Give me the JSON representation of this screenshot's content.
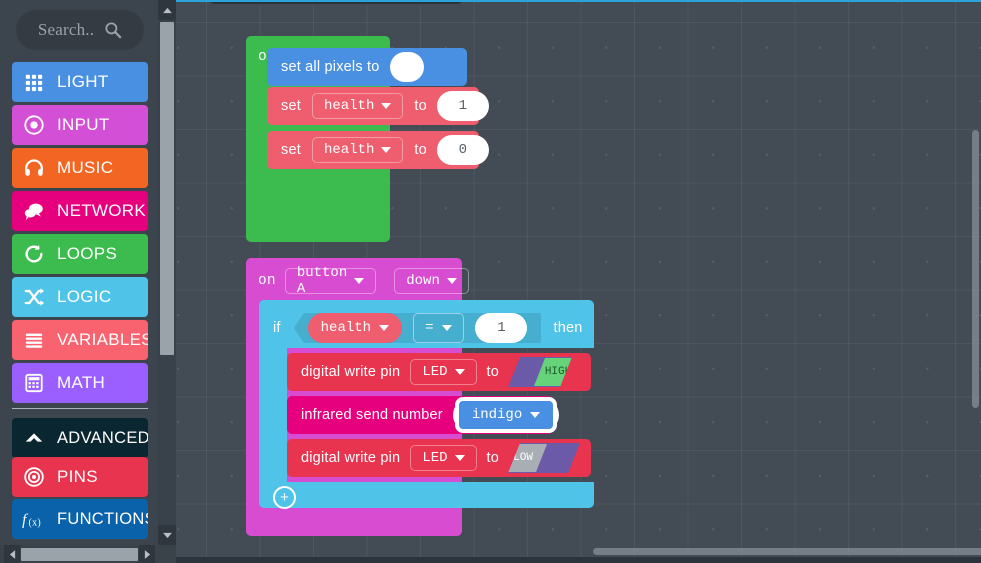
{
  "toolbox": {
    "search": {
      "placeholder": "Search..",
      "icon": "search-icon"
    },
    "categories": [
      {
        "label": "LIGHT",
        "icon": "grid-icon",
        "color": "#4a90e2"
      },
      {
        "label": "INPUT",
        "icon": "target-icon",
        "color": "#d34fd6"
      },
      {
        "label": "MUSIC",
        "icon": "headphones-icon",
        "color": "#f26522"
      },
      {
        "label": "NETWORK",
        "icon": "chat-icon",
        "color": "#e6007e"
      },
      {
        "label": "LOOPS",
        "icon": "refresh-icon",
        "color": "#3cbb4e"
      },
      {
        "label": "LOGIC",
        "icon": "shuffle-icon",
        "color": "#4fc3e8"
      },
      {
        "label": "VARIABLES",
        "icon": "lines-icon",
        "color": "#f9636f"
      },
      {
        "label": "MATH",
        "icon": "calculator-icon",
        "color": "#9b5fff"
      },
      {
        "label": "ADVANCED",
        "icon": "chevron-up-icon",
        "color": "#0a2630"
      },
      {
        "label": "PINS",
        "icon": "bullseye-icon",
        "color": "#e8344e"
      },
      {
        "label": "FUNCTIONS",
        "icon": "fx-icon",
        "color": "#0a62ab"
      }
    ],
    "scroll_up_icon": "chevron-up-icon",
    "scroll_down_icon": "chevron-down-icon",
    "scroll_left_icon": "chevron-left-icon",
    "scroll_right_icon": "chevron-right-icon"
  },
  "workspace": {
    "on_start": {
      "label": "on start",
      "color": "#3cbb4e",
      "statements": {
        "set_all_pixels": {
          "text": "set all pixels to",
          "color": "#4a90e2",
          "value_swatch": "#ffffff"
        },
        "set_health_1": {
          "keyword": "set",
          "variable": "health",
          "to": "to",
          "value": "1",
          "color": "#ee5e6e"
        },
        "set_health_0": {
          "keyword": "set",
          "variable": "health",
          "to": "to",
          "value": "0",
          "color": "#ee5e6e"
        }
      }
    },
    "on_button": {
      "keyword": "on",
      "button": "button A",
      "event": "down",
      "color": "#d74cd0"
    },
    "if_block": {
      "if_label": "if",
      "then_label": "then",
      "color": "#4fc3e8",
      "condition": {
        "left_variable": "health",
        "operator": "=",
        "right_value": "1"
      },
      "add_icon": "plus-circle-icon",
      "statements": [
        {
          "text": "digital write pin",
          "pin": "LED",
          "to": "to",
          "value": "HIGH",
          "value_color": "#64d37a",
          "color": "#e8344e"
        },
        {
          "text": "infrared send number",
          "value": "indigo",
          "color": "#e6007e",
          "selected": true
        },
        {
          "text": "digital write pin",
          "pin": "LED",
          "to": "to",
          "value": "LOW",
          "value_color": "#a8aeb4",
          "color": "#e8344e"
        }
      ]
    }
  }
}
